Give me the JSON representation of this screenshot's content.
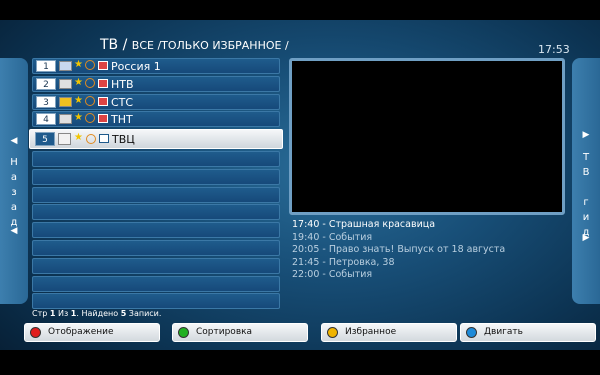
{
  "header": {
    "title_main": "ТВ / ",
    "title_sub": "ВСЕ /ТОЛЬКО ИЗБРАННОЕ /",
    "clock": "17:53"
  },
  "left_tab": {
    "arrow_up": "◀",
    "arrow_down": "◀",
    "letters": [
      "Н",
      "а",
      "з",
      "а",
      "д"
    ]
  },
  "right_tab": {
    "arrow_up": "▶",
    "arrow_down": "▶",
    "letters": [
      "Т",
      "В",
      "",
      "г",
      "и",
      "д"
    ]
  },
  "channels": [
    {
      "num": "1",
      "name": "Россия 1",
      "logo_color": "#c8d8ef"
    },
    {
      "num": "2",
      "name": "НТВ",
      "logo_color": "#e0e0e0"
    },
    {
      "num": "3",
      "name": "СТС",
      "logo_color": "#f0c020"
    },
    {
      "num": "4",
      "name": "ТНТ",
      "logo_color": "#e0e0e0"
    },
    {
      "num": "5",
      "name": "ТВЦ",
      "logo_color": "#f2f2f2"
    }
  ],
  "selected_index": 4,
  "empty_rows": 9,
  "status": {
    "page_label": "Стр ",
    "page": "1",
    "of_label": " Из ",
    "total_pages": "1",
    "found_label": ". Найдено ",
    "count": "5",
    "records_label": " Записи."
  },
  "epg": [
    {
      "time": "17:40",
      "title": "Страшная красавица",
      "current": true
    },
    {
      "time": "19:40",
      "title": "События",
      "current": false
    },
    {
      "time": "20:05",
      "title": "Право знать! Выпуск от 18 августа",
      "current": false
    },
    {
      "time": "21:45",
      "title": "Петровка, 38",
      "current": false
    },
    {
      "time": "22:00",
      "title": "События",
      "current": false
    }
  ],
  "buttons": [
    {
      "label": "Отображение",
      "color": "#e01e1e"
    },
    {
      "label": "Сортировка",
      "color": "#22b022"
    },
    {
      "label": "Избранное",
      "color": "#f0b400"
    },
    {
      "label": "Двигать",
      "color": "#1e8ad8"
    }
  ],
  "colors": {
    "accent": "#1e5a8c",
    "background": "#184f78"
  }
}
